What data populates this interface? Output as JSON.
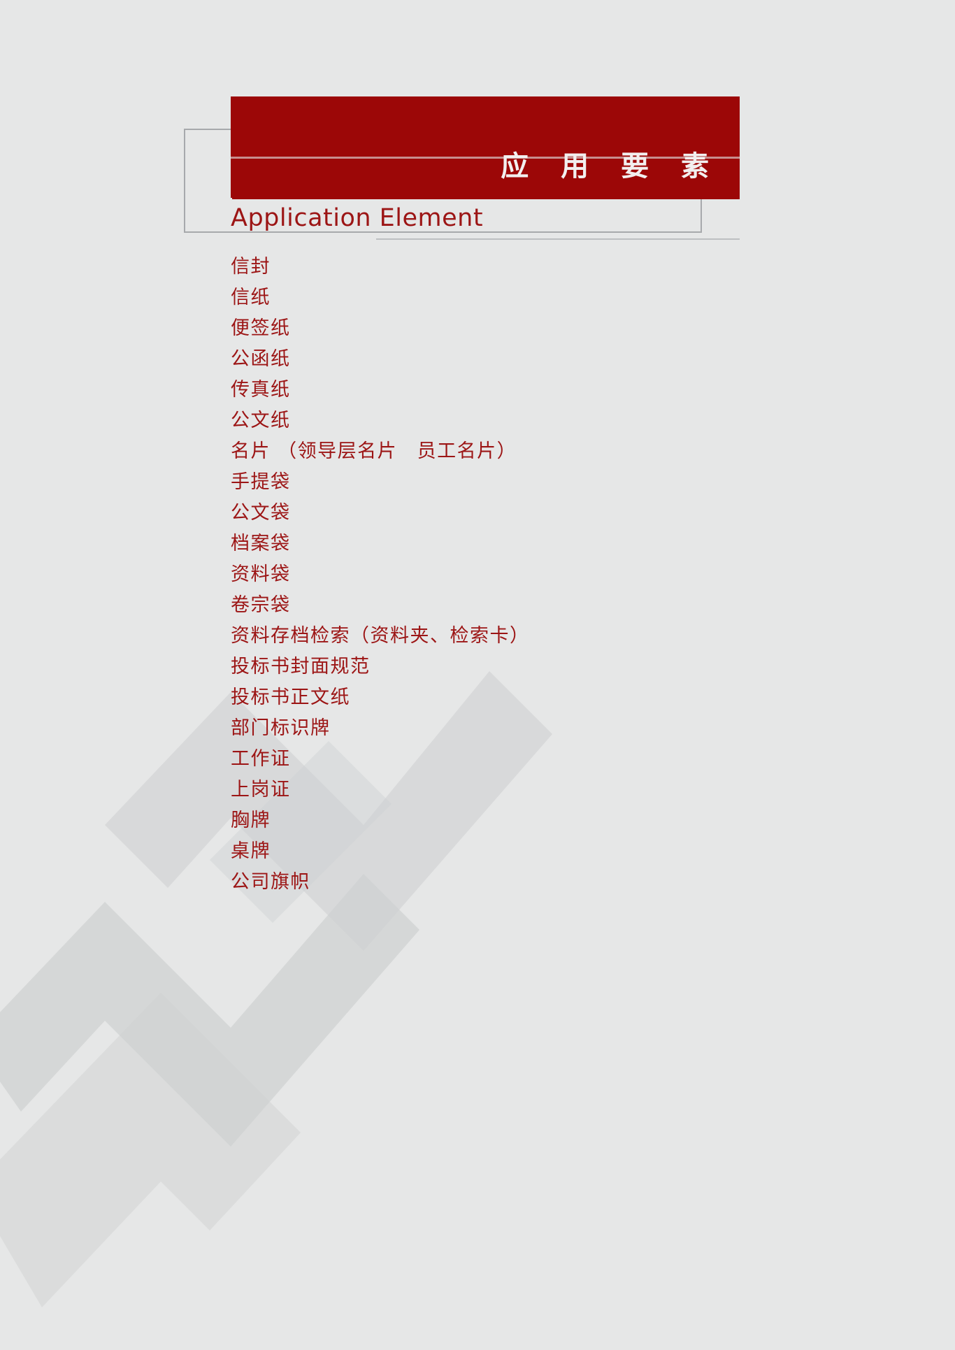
{
  "page": {
    "background_color": "#e6e7e7",
    "accent_color": "#9c0707",
    "text_color": "#9c1515",
    "outline_color": "#a7a9ac"
  },
  "header": {
    "title_cn": "应 用 要 素",
    "title_en": "Application  Element"
  },
  "list": {
    "items": [
      {
        "label": "信封"
      },
      {
        "label": "信纸"
      },
      {
        "label": "便签纸"
      },
      {
        "label": "公函纸"
      },
      {
        "label": "传真纸"
      },
      {
        "label": "公文纸"
      },
      {
        "label": "名片 （领导层名片　员工名片）"
      },
      {
        "label": "手提袋"
      },
      {
        "label": "公文袋"
      },
      {
        "label": "档案袋"
      },
      {
        "label": "资料袋"
      },
      {
        "label": "卷宗袋"
      },
      {
        "label": "资料存档检索（资料夹、检索卡）"
      },
      {
        "label": "投标书封面规范"
      },
      {
        "label": "投标书正文纸"
      },
      {
        "label": "部门标识牌"
      },
      {
        "label": "工作证"
      },
      {
        "label": "上岗证"
      },
      {
        "label": "胸牌"
      },
      {
        "label": "桌牌"
      },
      {
        "label": "公司旗帜"
      }
    ]
  },
  "watermark": {
    "shape": "chevron-arrows",
    "color": "#cfd1d2"
  }
}
